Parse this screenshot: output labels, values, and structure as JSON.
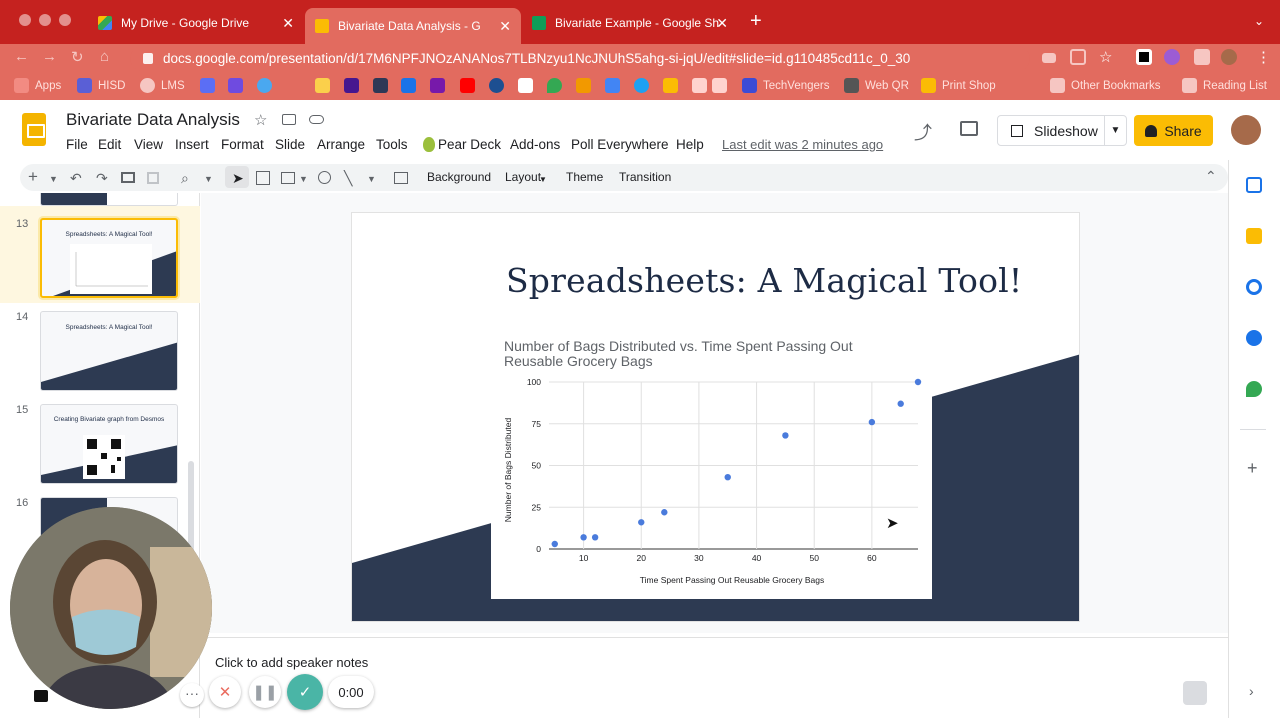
{
  "browser": {
    "tabs": [
      {
        "title": "My Drive - Google Drive",
        "active": false
      },
      {
        "title": "Bivariate Data Analysis - G",
        "active": true
      },
      {
        "title": "Bivariate Example - Google Sh",
        "active": false
      }
    ],
    "url": "docs.google.com/presentation/d/17M6NPFJNOzANANos7TLBNzyu1NcJNUhS5ahg-si-jqU/edit#slide=id.g110485cd11c_0_30",
    "bookmarks": [
      "Apps",
      "HISD",
      "LMS",
      "TechVengers",
      "Web QR",
      "Print Shop"
    ],
    "bookmarks_right": [
      "Other Bookmarks",
      "Reading List"
    ]
  },
  "doc": {
    "title": "Bivariate Data Analysis",
    "menus": [
      "File",
      "Edit",
      "View",
      "Insert",
      "Format",
      "Slide",
      "Arrange",
      "Tools",
      "Pear Deck",
      "Add-ons",
      "Poll Everywhere",
      "Help"
    ],
    "last_edit": "Last edit was 2 minutes ago",
    "slideshow_label": "Slideshow",
    "share_label": "Share"
  },
  "toolbar": {
    "background": "Background",
    "layout": "Layout",
    "theme": "Theme",
    "transition": "Transition"
  },
  "filmstrip": {
    "slides": [
      {
        "num": "13",
        "title": "Spreadsheets: A Magical Tool!"
      },
      {
        "num": "14",
        "title": "Spreadsheets: A Magical Tool!"
      },
      {
        "num": "15",
        "title": "Creating Bivariate graph from Desmos"
      },
      {
        "num": "16",
        "title": ""
      }
    ]
  },
  "slide": {
    "title": "Spreadsheets: A Magical Tool!"
  },
  "chart_data": {
    "type": "scatter",
    "title": "Number of Bags Distributed vs. Time Spent Passing Out Reusable Grocery Bags",
    "xlabel": "Time Spent Passing Out Reusable Grocery Bags",
    "ylabel": "Number of Bags Distributed",
    "xlim": [
      4,
      68
    ],
    "ylim": [
      0,
      100
    ],
    "xticks": [
      10,
      20,
      30,
      40,
      50,
      60
    ],
    "yticks": [
      0,
      25,
      50,
      75,
      100
    ],
    "grid": true,
    "color": "#4a7bdc",
    "x": [
      5,
      10,
      12,
      20,
      24,
      35,
      45,
      60,
      65,
      68
    ],
    "y": [
      3,
      7,
      7,
      16,
      22,
      43,
      68,
      76,
      87,
      100
    ]
  },
  "notes": {
    "placeholder": "Click to add speaker notes"
  },
  "recorder": {
    "time": "0:00"
  }
}
